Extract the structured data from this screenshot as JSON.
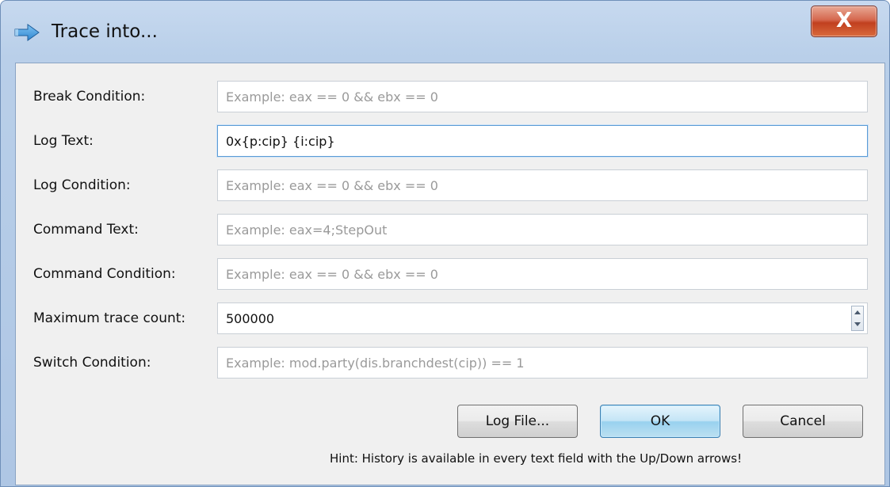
{
  "window": {
    "title": "Trace into...",
    "close_glyph": "X",
    "icon": "trace-arrow-icon"
  },
  "fields": {
    "break_condition": {
      "label": "Break Condition:",
      "value": "",
      "placeholder": "Example: eax == 0 && ebx == 0"
    },
    "log_text": {
      "label": "Log Text:",
      "value": "0x{p:cip} {i:cip}",
      "placeholder": ""
    },
    "log_condition": {
      "label": "Log Condition:",
      "value": "",
      "placeholder": "Example: eax == 0 && ebx == 0"
    },
    "command_text": {
      "label": "Command Text:",
      "value": "",
      "placeholder": "Example: eax=4;StepOut"
    },
    "command_condition": {
      "label": "Command Condition:",
      "value": "",
      "placeholder": "Example: eax == 0 && ebx == 0"
    },
    "max_trace_count": {
      "label": "Maximum trace count:",
      "value": "500000"
    },
    "switch_condition": {
      "label": "Switch Condition:",
      "value": "",
      "placeholder": "Example: mod.party(dis.branchdest(cip)) == 1"
    }
  },
  "buttons": {
    "log_file": "Log File...",
    "ok": "OK",
    "cancel": "Cancel"
  },
  "hint": "Hint: History is available in every text field with the Up/Down arrows!",
  "colors": {
    "accent_blue": "#3c7fb1",
    "close_red": "#c1401f"
  }
}
